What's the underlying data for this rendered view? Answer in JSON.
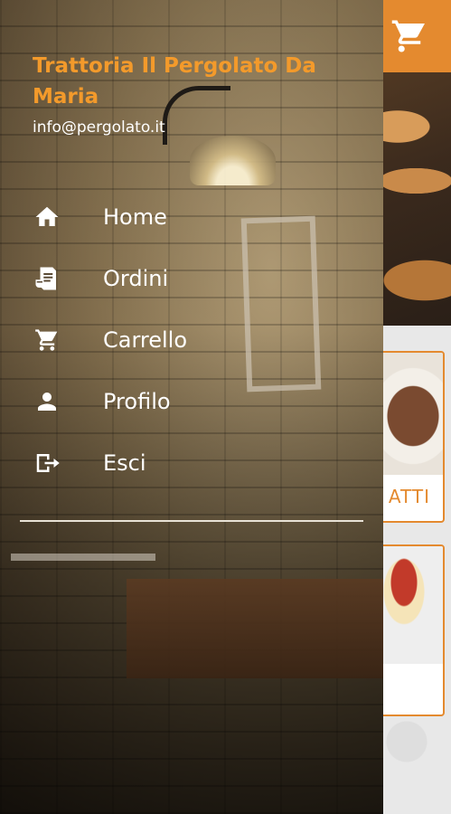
{
  "app": {
    "header_color": "#e48a2f",
    "cart_icon": "shopping-cart-icon",
    "categories": [
      {
        "label": "ATTI"
      },
      {
        "label": ""
      }
    ]
  },
  "drawer": {
    "restaurant_name": "Trattoria Il Pergolato Da Maria",
    "email": "info@pergolato.it",
    "accent_color": "#f39a2b",
    "menu": [
      {
        "label": "Home",
        "icon": "home-icon"
      },
      {
        "label": "Ordini",
        "icon": "receipt-icon"
      },
      {
        "label": "Carrello",
        "icon": "shopping-cart-icon"
      },
      {
        "label": "Profilo",
        "icon": "user-icon"
      },
      {
        "label": "Esci",
        "icon": "logout-icon"
      }
    ]
  }
}
